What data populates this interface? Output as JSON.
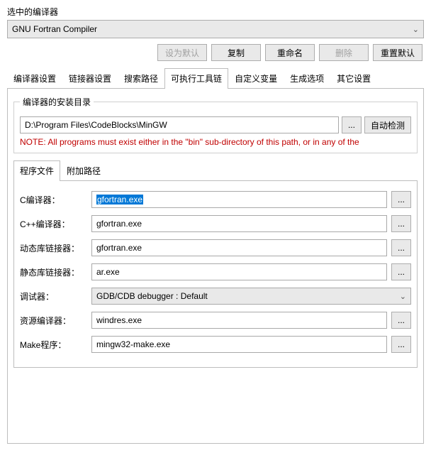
{
  "section_label": "选中的编译器",
  "selected_compiler": "GNU Fortran Compiler",
  "top_buttons": {
    "set_default": "设为默认",
    "copy": "复制",
    "rename": "重命名",
    "delete": "删除",
    "reset_defaults": "重置默认"
  },
  "main_tabs": [
    "编译器设置",
    "链接器设置",
    "搜索路径",
    "可执行工具链",
    "自定义变量",
    "生成选项",
    "其它设置"
  ],
  "main_tab_active_index": 3,
  "install_group": {
    "legend": "编译器的安装目录",
    "path": "D:\\Program Files\\CodeBlocks\\MinGW",
    "browse": "...",
    "autodetect": "自动检测",
    "note": "NOTE: All programs must exist either in the \"bin\" sub-directory of this path, or in any of the"
  },
  "sub_tabs": [
    "程序文件",
    "附加路径"
  ],
  "sub_tab_active_index": 0,
  "rows": {
    "c_compiler": {
      "label": "C编译器：",
      "value": "gfortran.exe",
      "highlighted": true
    },
    "cpp_compiler": {
      "label": "C++编译器：",
      "value": "gfortran.exe"
    },
    "dyn_linker": {
      "label": "动态库链接器：",
      "value": "gfortran.exe"
    },
    "static_linker": {
      "label": "静态库链接器：",
      "value": "ar.exe"
    },
    "debugger": {
      "label": "调试器：",
      "value": "GDB/CDB debugger : Default"
    },
    "res_compiler": {
      "label": "资源编译器：",
      "value": "windres.exe"
    },
    "make": {
      "label": "Make程序：",
      "value": "mingw32-make.exe"
    }
  },
  "browse_label": "..."
}
